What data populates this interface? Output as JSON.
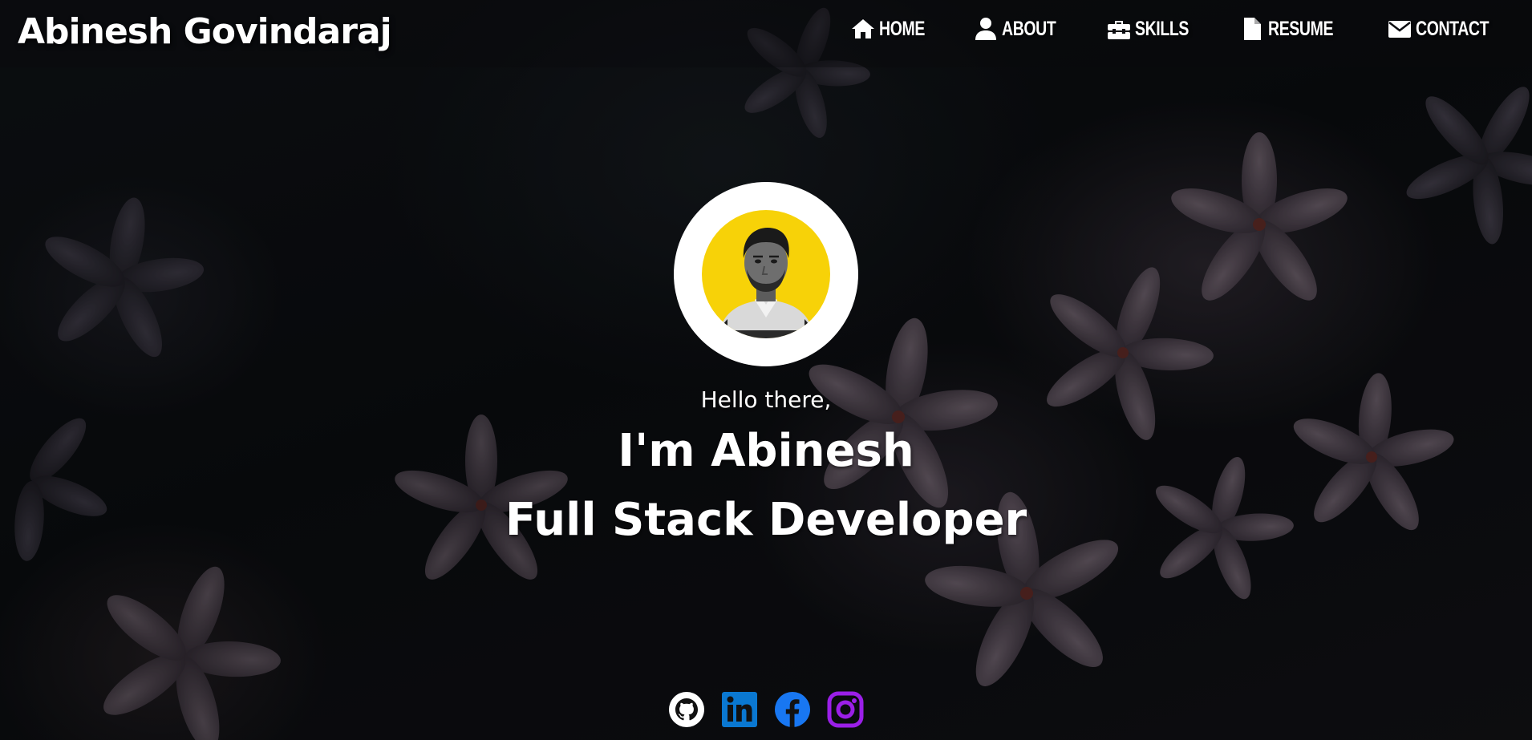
{
  "brand": {
    "name": "Abinesh Govindaraj"
  },
  "nav": {
    "items": [
      {
        "label": "HOME",
        "icon": "home-icon"
      },
      {
        "label": "ABOUT",
        "icon": "user-icon"
      },
      {
        "label": "SKILLS",
        "icon": "toolbox-icon"
      },
      {
        "label": "RESUME",
        "icon": "file-icon"
      },
      {
        "label": "CONTACT",
        "icon": "envelope-icon"
      }
    ]
  },
  "hero": {
    "greeting": "Hello there,",
    "name_line": "I'm Abinesh",
    "role_line": "Full Stack Developer",
    "avatar_icon": "profile-photo",
    "avatar_bg_color": "#f7d208"
  },
  "socials": [
    {
      "icon": "github-icon",
      "color": "#ffffff"
    },
    {
      "icon": "linkedin-icon",
      "color": "#0a66c2"
    },
    {
      "icon": "facebook-icon",
      "color": "#1877f2"
    },
    {
      "icon": "instagram-icon",
      "color": "#9b1fe8"
    }
  ]
}
